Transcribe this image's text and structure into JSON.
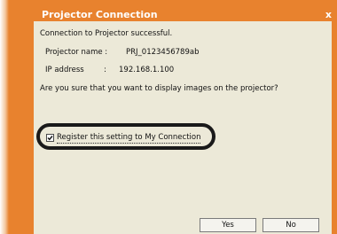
{
  "window": {
    "title": "Projector Connection",
    "close_symbol": "x"
  },
  "dialog": {
    "status_message": "Connection to Projector successful.",
    "projector_name_label": "Projector name :",
    "projector_name_value": "PRJ_0123456789ab",
    "ip_address_label": "IP address",
    "ip_address_separator": ":",
    "ip_address_value": "192.168.1.100",
    "question": "Are you sure that you want to display images on the projector?",
    "checkbox_label": "Register this setting to My Connection",
    "checkbox_checked": true
  },
  "buttons": {
    "yes_label": "Yes",
    "no_label": "No"
  },
  "colors": {
    "frame_orange": "#e8822e",
    "dialog_background": "#ece9d8",
    "highlight_ring": "#1a1a1a"
  },
  "icons": {
    "close": "close-icon",
    "check": "checkmark-icon"
  }
}
